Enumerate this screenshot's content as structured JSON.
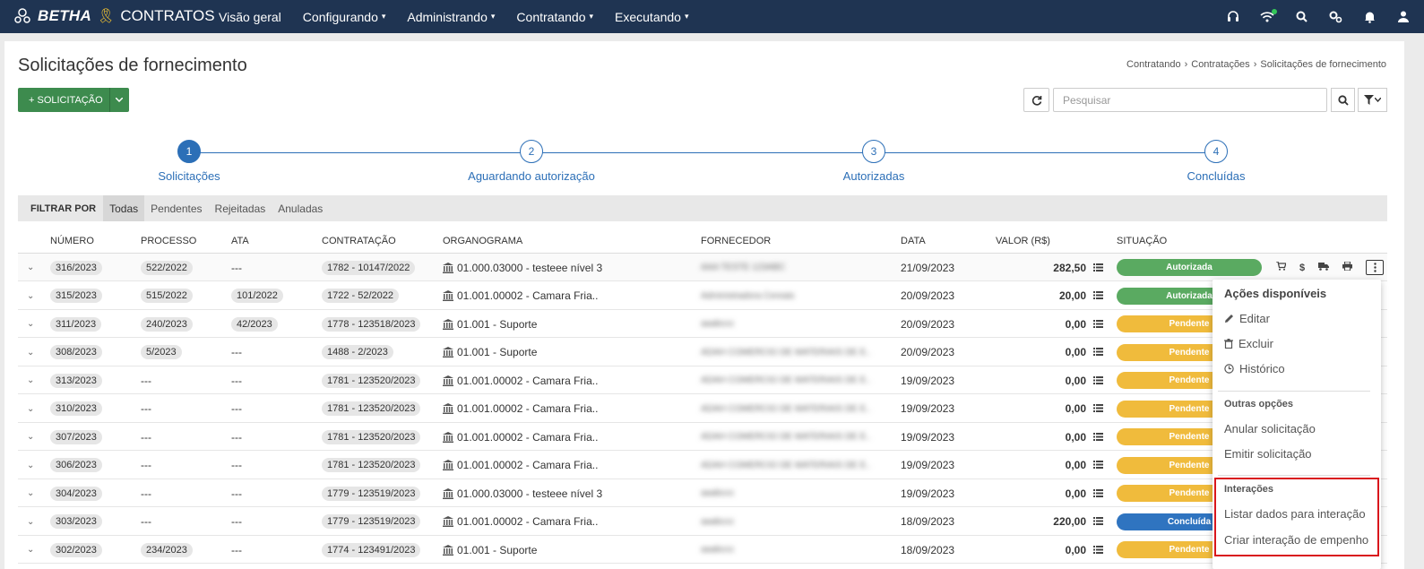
{
  "app": {
    "brand": "BETHA",
    "product": "CONTRATOS"
  },
  "nav": [
    {
      "label": "Visão geral",
      "dropdown": false
    },
    {
      "label": "Configurando",
      "dropdown": true
    },
    {
      "label": "Administrando",
      "dropdown": true
    },
    {
      "label": "Contratando",
      "dropdown": true
    },
    {
      "label": "Executando",
      "dropdown": true
    }
  ],
  "top_icons": [
    "headset-icon",
    "wifi-icon",
    "search-icon",
    "settings-icon",
    "bell-icon",
    "user-icon"
  ],
  "page": {
    "title": "Solicitações de fornecimento",
    "breadcrumb": [
      "Contratando",
      "Contratações",
      "Solicitações de fornecimento"
    ],
    "new_button": "+ SOLICITAÇÃO",
    "search_placeholder": "Pesquisar"
  },
  "steps": [
    {
      "num": "1",
      "label": "Solicitações",
      "active": true
    },
    {
      "num": "2",
      "label": "Aguardando autorização",
      "active": false
    },
    {
      "num": "3",
      "label": "Autorizadas",
      "active": false
    },
    {
      "num": "4",
      "label": "Concluídas",
      "active": false
    }
  ],
  "filter": {
    "label": "FILTRAR POR",
    "tabs": [
      "Todas",
      "Pendentes",
      "Rejeitadas",
      "Anuladas"
    ],
    "active": "Todas"
  },
  "columns": [
    "NÚMERO",
    "PROCESSO",
    "ATA",
    "CONTRATAÇÃO",
    "ORGANOGRAMA",
    "FORNECEDOR",
    "DATA",
    "VALOR (R$)",
    "SITUAÇÃO"
  ],
  "rows": [
    {
      "numero": "316/2023",
      "processo": "522/2022",
      "ata": "---",
      "contratacao": "1782 - 10147/2022",
      "organograma": "01.000.03000 - testeee nível 3",
      "fornecedor": "AAA TESTE 123ABC",
      "data": "21/09/2023",
      "valor": "282,50",
      "situacao": "Autorizada"
    },
    {
      "numero": "315/2023",
      "processo": "515/2022",
      "ata": "101/2022",
      "contratacao": "1722 - 52/2022",
      "organograma": "01.001.00002 - Camara Fria..",
      "fornecedor": "Administradora Cereais",
      "data": "20/09/2023",
      "valor": "20,00",
      "situacao": "Autorizada"
    },
    {
      "numero": "311/2023",
      "processo": "240/2023",
      "ata": "42/2023",
      "contratacao": "1778 - 123518/2023",
      "organograma": "01.001 - Suporte",
      "fornecedor": "aaabccc",
      "data": "20/09/2023",
      "valor": "0,00",
      "situacao": "Pendente"
    },
    {
      "numero": "308/2023",
      "processo": "5/2023",
      "ata": "---",
      "contratacao": "1488 - 2/2023",
      "organograma": "01.001 - Suporte",
      "fornecedor": "ADAH COMERCIO DE MATERIAIS DE E..",
      "data": "20/09/2023",
      "valor": "0,00",
      "situacao": "Pendente"
    },
    {
      "numero": "313/2023",
      "processo": "---",
      "ata": "---",
      "contratacao": "1781 - 123520/2023",
      "organograma": "01.001.00002 - Camara Fria..",
      "fornecedor": "ADAH COMERCIO DE MATERIAIS DE E..",
      "data": "19/09/2023",
      "valor": "0,00",
      "situacao": "Pendente"
    },
    {
      "numero": "310/2023",
      "processo": "---",
      "ata": "---",
      "contratacao": "1781 - 123520/2023",
      "organograma": "01.001.00002 - Camara Fria..",
      "fornecedor": "ADAH COMERCIO DE MATERIAIS DE E..",
      "data": "19/09/2023",
      "valor": "0,00",
      "situacao": "Pendente"
    },
    {
      "numero": "307/2023",
      "processo": "---",
      "ata": "---",
      "contratacao": "1781 - 123520/2023",
      "organograma": "01.001.00002 - Camara Fria..",
      "fornecedor": "ADAH COMERCIO DE MATERIAIS DE E..",
      "data": "19/09/2023",
      "valor": "0,00",
      "situacao": "Pendente"
    },
    {
      "numero": "306/2023",
      "processo": "---",
      "ata": "---",
      "contratacao": "1781 - 123520/2023",
      "organograma": "01.001.00002 - Camara Fria..",
      "fornecedor": "ADAH COMERCIO DE MATERIAIS DE E..",
      "data": "19/09/2023",
      "valor": "0,00",
      "situacao": "Pendente"
    },
    {
      "numero": "304/2023",
      "processo": "---",
      "ata": "---",
      "contratacao": "1779 - 123519/2023",
      "organograma": "01.000.03000 - testeee nível 3",
      "fornecedor": "aaabccc",
      "data": "19/09/2023",
      "valor": "0,00",
      "situacao": "Pendente"
    },
    {
      "numero": "303/2023",
      "processo": "---",
      "ata": "---",
      "contratacao": "1779 - 123519/2023",
      "organograma": "01.001.00002 - Camara Fria..",
      "fornecedor": "aaabccc",
      "data": "18/09/2023",
      "valor": "220,00",
      "situacao": "Concluída"
    },
    {
      "numero": "302/2023",
      "processo": "234/2023",
      "ata": "---",
      "contratacao": "1774 - 123491/2023",
      "organograma": "01.001 - Suporte",
      "fornecedor": "aaabccc",
      "data": "18/09/2023",
      "valor": "0,00",
      "situacao": "Pendente"
    }
  ],
  "status_colors": {
    "Autorizada": "#5aaa61",
    "Pendente": "#f0bb3c",
    "Concluída": "#2f74c0"
  },
  "menu": {
    "title": "Ações disponíveis",
    "primary": [
      {
        "label": "Editar",
        "icon": "pencil-icon"
      },
      {
        "label": "Excluir",
        "icon": "trash-icon"
      },
      {
        "label": "Histórico",
        "icon": "clock-icon"
      }
    ],
    "other_title": "Outras opções",
    "other": [
      "Anular solicitação",
      "Emitir solicitação"
    ],
    "interactions_title": "Interações",
    "interactions": [
      "Listar dados para interação",
      "Criar interação de empenho"
    ]
  }
}
